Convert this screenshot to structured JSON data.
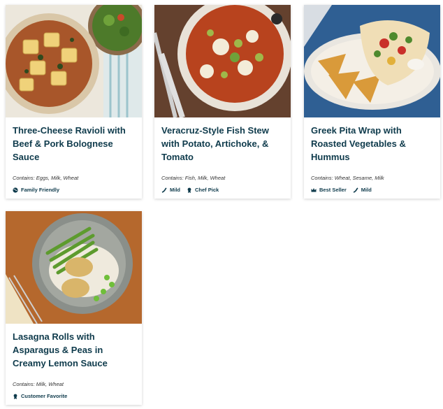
{
  "meals": [
    {
      "title": "Three-Cheese Ravioli with Beef & Pork Bolognese Sauce",
      "contains": "Contains: Eggs, Milk, Wheat",
      "tags": [
        {
          "icon": "globe-icon",
          "label": "Family Friendly"
        }
      ]
    },
    {
      "title": "Veracruz-Style Fish Stew with Potato, Artichoke, & Tomato",
      "contains": "Contains: Fish, Milk, Wheat",
      "tags": [
        {
          "icon": "pepper-icon",
          "label": "Mild"
        },
        {
          "icon": "ribbon-icon",
          "label": "Chef Pick"
        }
      ]
    },
    {
      "title": "Greek Pita Wrap with Roasted Vegetables & Hummus",
      "contains": "Contains: Wheat, Sesame, Milk",
      "tags": [
        {
          "icon": "crown-icon",
          "label": "Best Seller"
        },
        {
          "icon": "pepper-icon",
          "label": "Mild"
        }
      ]
    },
    {
      "title": "Lasagna Rolls with Asparagus & Peas in Creamy Lemon Sauce",
      "contains": "Contains: Milk, Wheat",
      "tags": [
        {
          "icon": "ribbon-icon",
          "label": "Customer Favorite"
        }
      ]
    }
  ],
  "colors": {
    "title": "#0f3b4c",
    "text": "#333333"
  }
}
